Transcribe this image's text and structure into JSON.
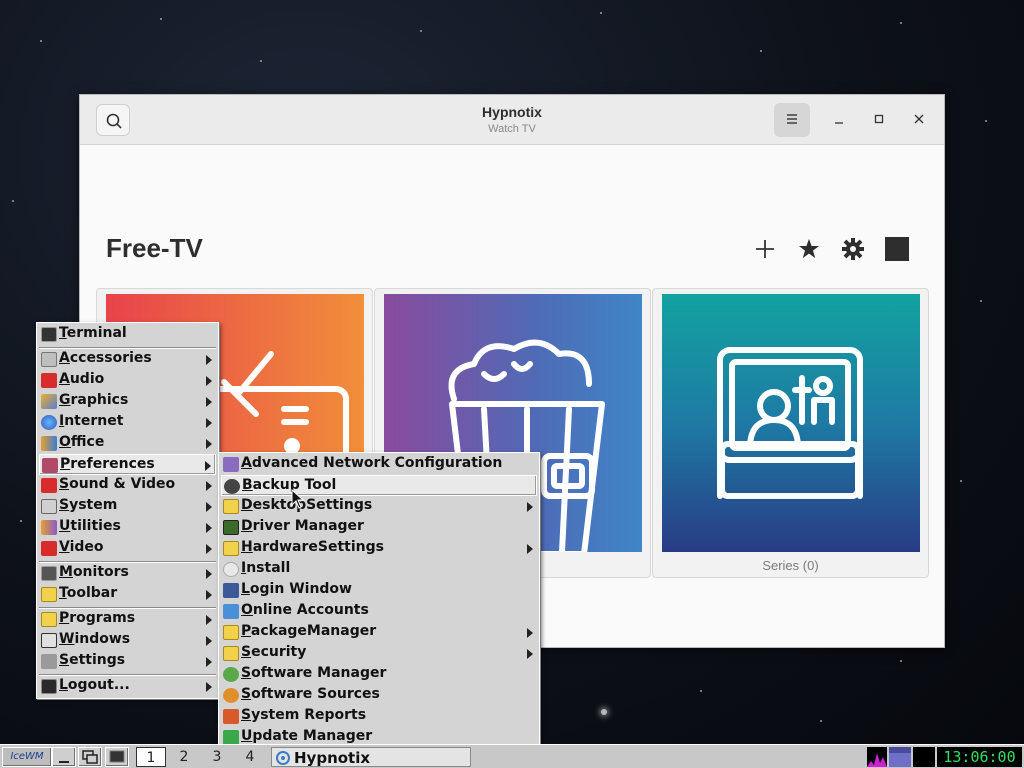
{
  "window": {
    "title": "Hypnotix",
    "subtitle": "Watch TV"
  },
  "content": {
    "title": "Free-TV",
    "cards": [
      {
        "label": "",
        "icon": "tv-icon"
      },
      {
        "label": "5)",
        "icon": "popcorn-icon"
      },
      {
        "label": "Series (0)",
        "icon": "series-icon"
      }
    ]
  },
  "main_menu": {
    "items": [
      {
        "label": "Terminal",
        "icon": "terminal-icon"
      },
      {
        "label": "Accessories",
        "icon": "accessories-icon"
      },
      {
        "label": "Audio",
        "icon": "audio-icon"
      },
      {
        "label": "Graphics",
        "icon": "graphics-icon"
      },
      {
        "label": "Internet",
        "icon": "internet-icon"
      },
      {
        "label": "Office",
        "icon": "office-icon"
      },
      {
        "label": "Preferences",
        "icon": "preferences-icon"
      },
      {
        "label": "Sound & Video",
        "icon": "sound-video-icon"
      },
      {
        "label": "System",
        "icon": "system-icon"
      },
      {
        "label": "Utilities",
        "icon": "utilities-icon"
      },
      {
        "label": "Video",
        "icon": "video-icon"
      },
      {
        "label": "Monitors",
        "icon": "monitors-icon"
      },
      {
        "label": "Toolbar",
        "icon": "toolbar-icon"
      },
      {
        "label": "Programs",
        "icon": "programs-icon"
      },
      {
        "label": "Windows",
        "icon": "windows-icon"
      },
      {
        "label": "Settings",
        "icon": "settings-icon"
      },
      {
        "label": "Logout...",
        "icon": "logout-icon"
      }
    ]
  },
  "preferences_menu": {
    "items": [
      {
        "label": "Advanced Network Configuration",
        "icon": "network-icon"
      },
      {
        "label": "Backup Tool",
        "icon": "backup-icon"
      },
      {
        "label": "DesktopSettings",
        "icon": "folder-icon"
      },
      {
        "label": "Driver Manager",
        "icon": "driver-icon"
      },
      {
        "label": "HardwareSettings",
        "icon": "folder-icon"
      },
      {
        "label": "Install",
        "icon": "install-icon"
      },
      {
        "label": "Login Window",
        "icon": "login-icon"
      },
      {
        "label": "Online Accounts",
        "icon": "accounts-icon"
      },
      {
        "label": "PackageManager",
        "icon": "folder-icon"
      },
      {
        "label": "Security",
        "icon": "folder-icon"
      },
      {
        "label": "Software Manager",
        "icon": "software-icon"
      },
      {
        "label": "Software Sources",
        "icon": "sources-icon"
      },
      {
        "label": "System Reports",
        "icon": "reports-icon"
      },
      {
        "label": "Update Manager",
        "icon": "update-icon"
      }
    ]
  },
  "taskbar": {
    "start_label": "IceWM",
    "workspaces": [
      "1",
      "2",
      "3",
      "4"
    ],
    "active_workspace": "1",
    "task_label": "Hypnotix",
    "clock": "13:06:00"
  },
  "colors": {
    "menu_bg": "#d4d4d4",
    "clock_text": "#30e060"
  }
}
